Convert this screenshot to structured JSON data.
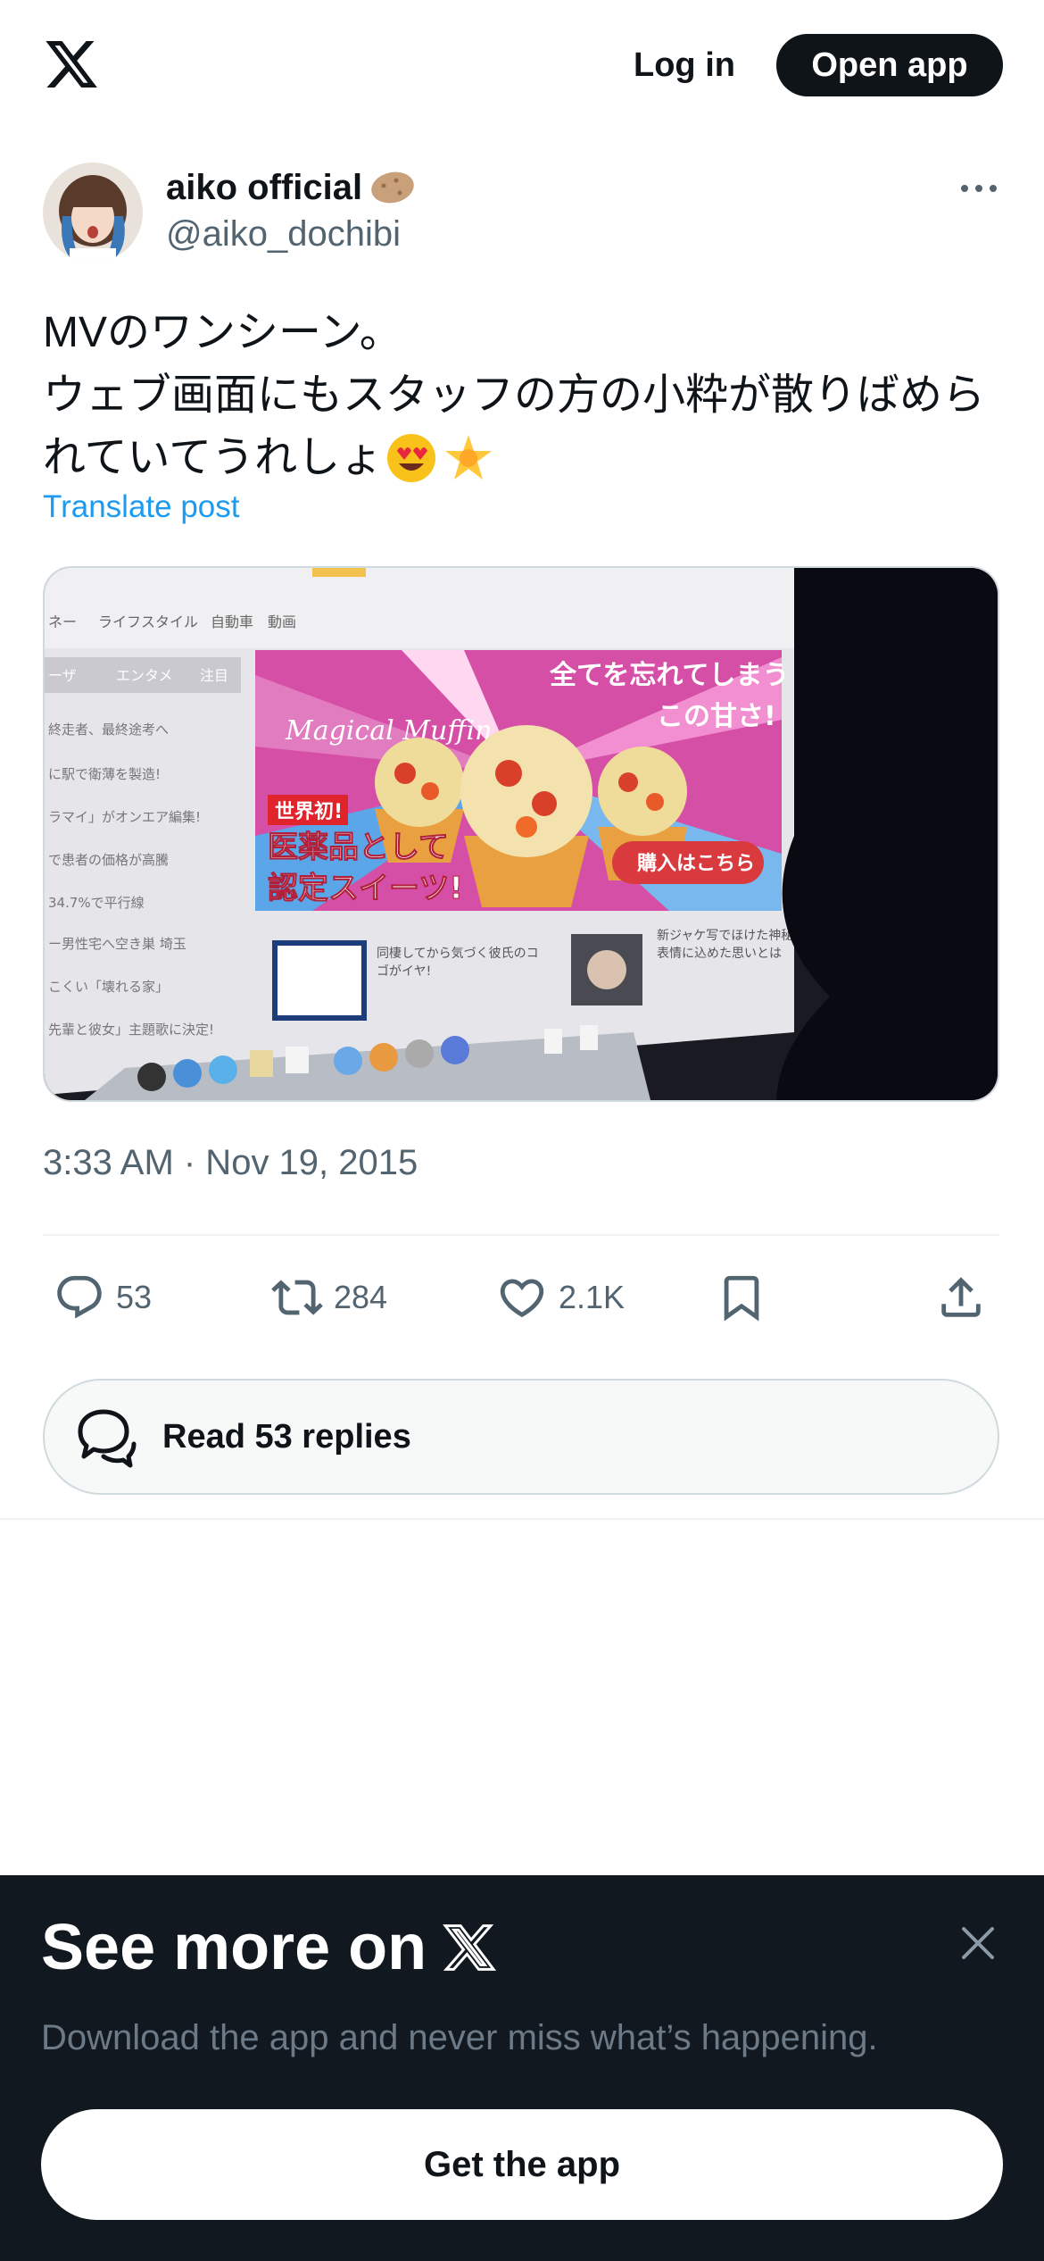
{
  "header": {
    "logo_icon": "x-logo-icon",
    "login_label": "Log in",
    "open_app_label": "Open app"
  },
  "author": {
    "name": "aiko official",
    "handle": "@aiko_dochibi",
    "name_emoji_icon": "potato-icon"
  },
  "post": {
    "text_lines": [
      "MVのワンシーン。",
      "ウェブ画面にもスタッフの方の小粋が散りばめら",
      "れていてうれしょ"
    ],
    "emoji_icons": [
      "heart-eyes-emoji-icon",
      "glowing-star-emoji-icon"
    ],
    "translate_label": "Translate post",
    "timestamp": "3:33 AM · Nov 19, 2015",
    "media": {
      "banner_brand": "Magical Muffin",
      "banner_line1": "全てを忘れてしまう",
      "banner_line2": "この甘さ!",
      "badge": "世界初!",
      "promo_line1": "医薬品として",
      "promo_line2": "認定スイーツ!",
      "buy_button": "購入はこちら",
      "nav_items": [
        "ネー",
        "ライフスタイル",
        "自動車",
        "動画"
      ],
      "side_tabs": [
        "ーザ",
        "エンタメ",
        "注目"
      ],
      "side_list": [
        "終走者、最終途考へ",
        "に駅で衛薄を製造!",
        "ラマイ」がオンエア編集!",
        "で患者の価格が高騰",
        "34.7%で平行線",
        "ー男性宅へ空き巣 埼玉",
        "こくい「壊れる家」",
        "先輩と彼女」主題歌に決定!"
      ],
      "caption1_line1": "同棲してから気づく彼氏のコ",
      "caption1_line2": "ゴがイヤ!",
      "caption2_line1": "新ジャケ写でほけた神秘的",
      "caption2_line2": "表情に込めた思いとは"
    }
  },
  "actions": {
    "reply_count": "53",
    "repost_count": "284",
    "like_count": "2.1K"
  },
  "replies_button": {
    "label": "Read 53 replies"
  },
  "sheet": {
    "title": "See more on",
    "subtitle": "Download the app and never miss what’s happening.",
    "cta": "Get the app"
  }
}
